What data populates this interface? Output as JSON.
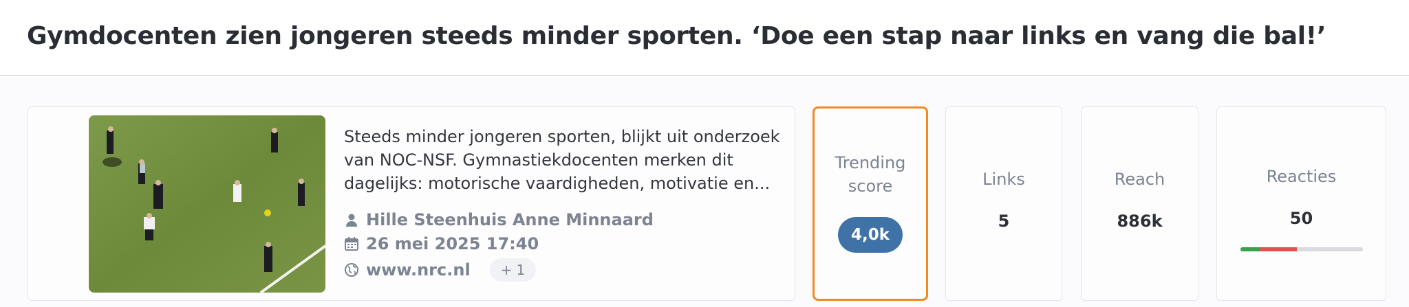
{
  "article": {
    "title": "Gymdocenten zien jongeren steeds minder sporten. ‘Doe een stap naar links en vang die bal!’",
    "summary": "Steeds minder jongeren sporten, blijkt uit onderzoek van NOC-NSF. Gymnastiekdocenten merken dit dagelijks: motorische vaardigheden, motivatie en...",
    "authors": "Hille Steenhuis Anne Minnaard",
    "date": "26 mei 2025 17:40",
    "source": "www.nrc.nl",
    "more_sources": "1",
    "icons": {
      "author": "person-icon",
      "date": "calendar-icon",
      "source": "globe-icon",
      "more": "plus-icon"
    }
  },
  "stats": {
    "trending": {
      "label": "Trending score",
      "value": "4,0k"
    },
    "links": {
      "label": "Links",
      "value": "5"
    },
    "reach": {
      "label": "Reach",
      "value": "886k"
    },
    "reacties": {
      "label": "Reacties",
      "value": "50",
      "sentiment": {
        "positive": 0.16,
        "negative": 0.3,
        "neutral": 0.54
      }
    }
  },
  "colors": {
    "accent_trending": "#f28a1f",
    "trending_pill": "#3f73a8",
    "sentiment_positive": "#3aa14a",
    "sentiment_negative": "#e0524f",
    "sentiment_neutral": "#d9dbe0"
  }
}
